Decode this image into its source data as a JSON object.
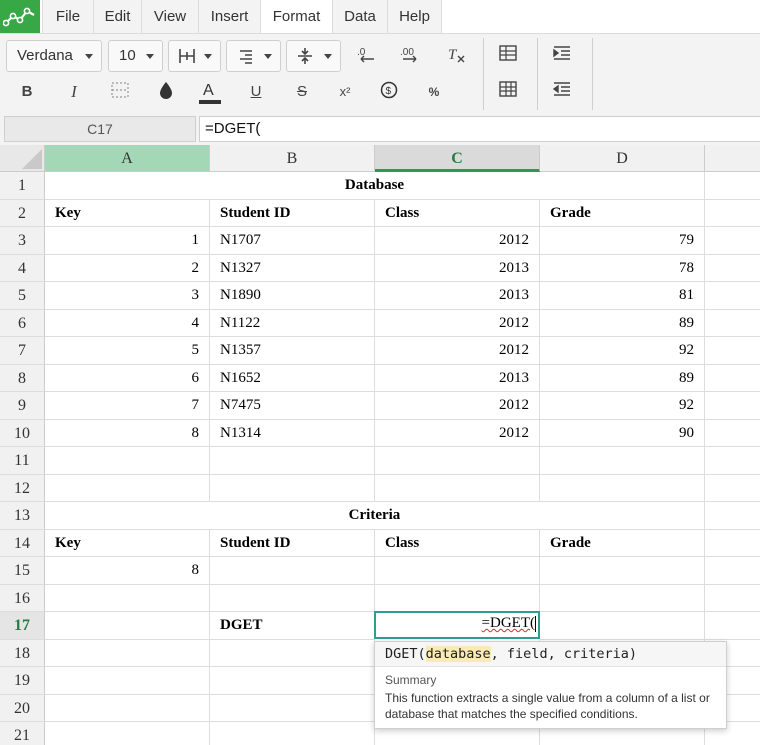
{
  "menu": {
    "items": [
      {
        "name": "menu-file",
        "label": "File"
      },
      {
        "name": "menu-edit",
        "label": "Edit"
      },
      {
        "name": "menu-view",
        "label": "View"
      },
      {
        "name": "menu-insert",
        "label": "Insert"
      },
      {
        "name": "menu-format",
        "label": "Format",
        "active": true
      },
      {
        "name": "menu-data",
        "label": "Data"
      },
      {
        "name": "menu-help",
        "label": "Help"
      }
    ]
  },
  "toolbar": {
    "font_family": "Verdana",
    "font_size": "10",
    "bold": "B",
    "italic": "I",
    "underline": "U",
    "strike": "S",
    "superscript": "x²",
    "currency": "$",
    "percent": "%"
  },
  "formula_bar": {
    "cell_ref": "C17",
    "value": "=DGET("
  },
  "columns": [
    "A",
    "B",
    "C",
    "D"
  ],
  "rows": [
    "1",
    "2",
    "3",
    "4",
    "5",
    "6",
    "7",
    "8",
    "9",
    "10",
    "11",
    "12",
    "13",
    "14",
    "15",
    "16",
    "17",
    "18",
    "19",
    "20",
    "21"
  ],
  "sheet": {
    "db_title": "Database",
    "headers": [
      "Key",
      "Student ID",
      "Class",
      "Grade"
    ],
    "records": [
      [
        "1",
        "N1707",
        "2012",
        "79"
      ],
      [
        "2",
        "N1327",
        "2013",
        "78"
      ],
      [
        "3",
        "N1890",
        "2013",
        "81"
      ],
      [
        "4",
        "N1122",
        "2012",
        "89"
      ],
      [
        "5",
        "N1357",
        "2012",
        "92"
      ],
      [
        "6",
        "N1652",
        "2013",
        "89"
      ],
      [
        "7",
        "N7475",
        "2012",
        "92"
      ],
      [
        "8",
        "N1314",
        "2012",
        "90"
      ]
    ],
    "criteria_title": "Criteria",
    "criteria_headers": [
      "Key",
      "Student ID",
      "Class",
      "Grade"
    ],
    "criteria_key": "8",
    "dget_label": "DGET",
    "active_cell_fn": "=DGET",
    "active_cell_paren": "("
  },
  "tooltip": {
    "sig_fn": "DGET(",
    "sig_arg1": "database",
    "sig_rest": ", field, criteria)",
    "summary_title": "Summary",
    "summary": "This function extracts a single value from a column of a list or database that matches the specified conditions."
  },
  "colors": {
    "brand": "#38a846",
    "active_border": "#2e9e8e",
    "active_header": "#2a7a45"
  }
}
